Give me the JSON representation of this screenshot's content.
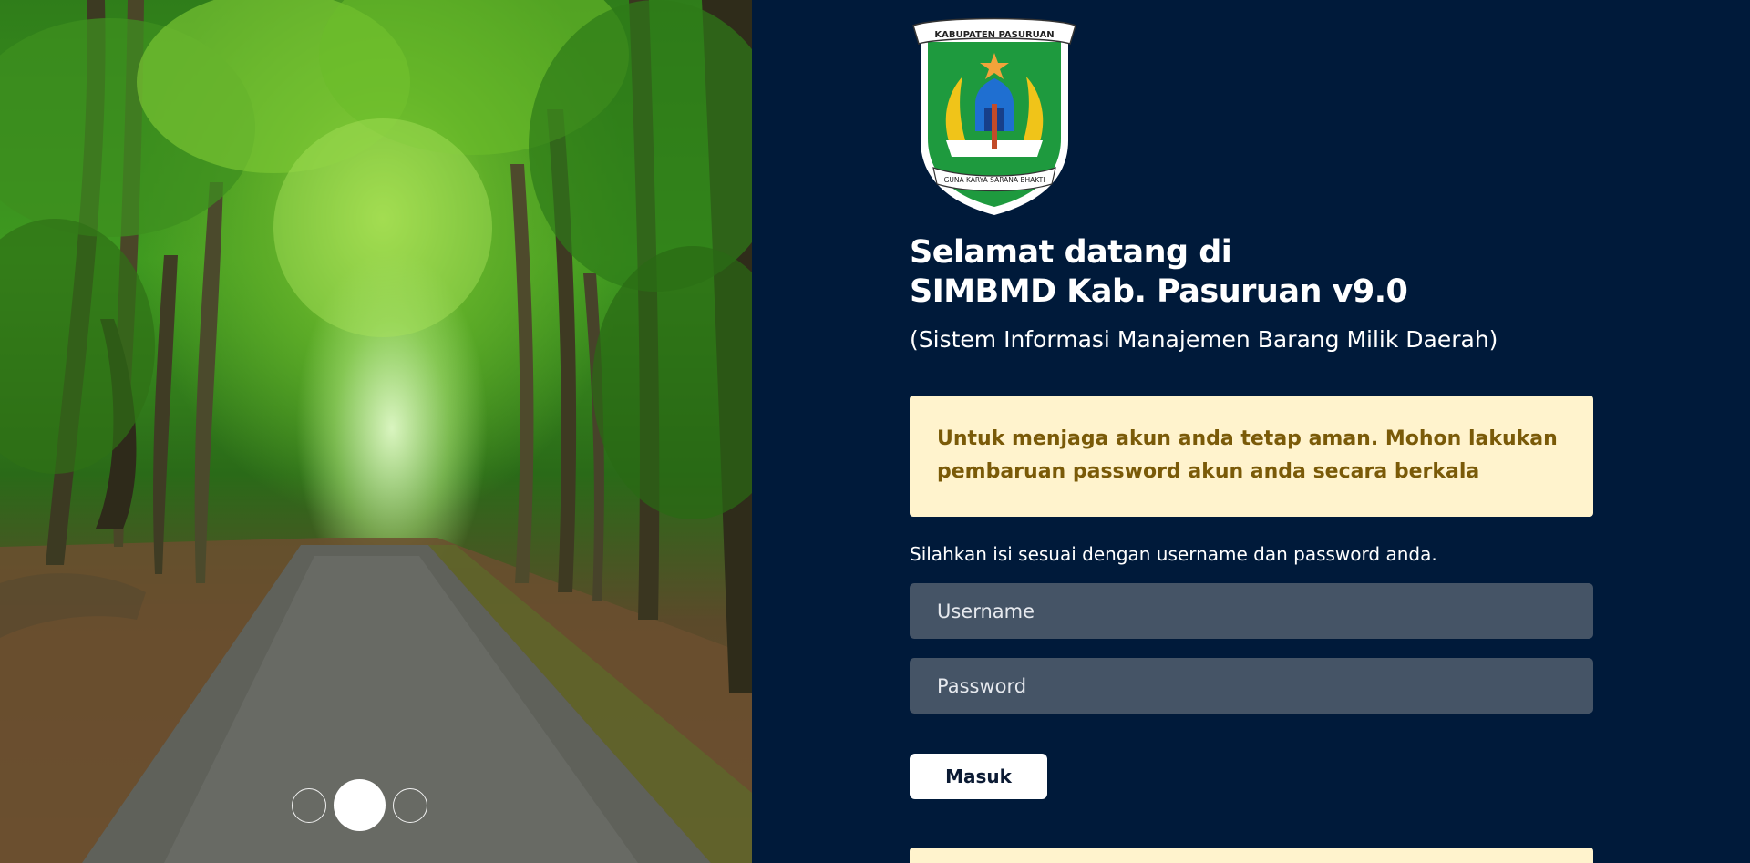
{
  "header": {
    "welcome_line1": "Selamat datang di",
    "welcome_line2": "SIMBMD Kab. Pasuruan v9.0",
    "subtitle": "(Sistem Informasi Manajemen Barang Milik Daerah)"
  },
  "logo": {
    "banner_text": "KABUPATEN PASURUAN",
    "motto_text": "GUNA KARYA SARANA BHAKTI"
  },
  "alert": {
    "message": "Untuk menjaga akun anda tetap aman. Mohon lakukan pembaruan password akun anda secara berkala"
  },
  "form": {
    "instruction": "Silahkan isi sesuai dengan username dan password anda.",
    "username_placeholder": "Username",
    "username_value": "",
    "password_placeholder": "Password",
    "password_value": "",
    "submit_label": "Masuk"
  },
  "carousel": {
    "slide_count": 3,
    "active_index": 1
  },
  "colors": {
    "page_background": "#001a3a",
    "alert_background": "#fff3cd",
    "alert_text": "#7a5a08",
    "input_background": "#455466",
    "button_background": "#ffffff"
  }
}
